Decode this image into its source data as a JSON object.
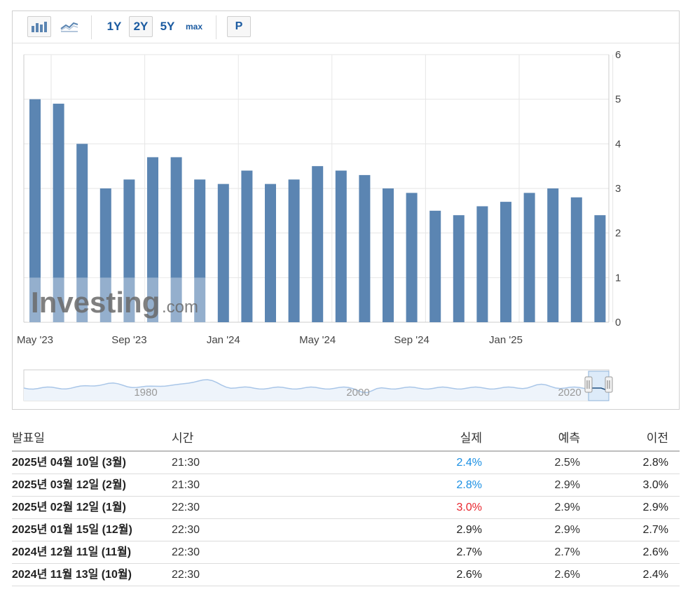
{
  "toolbar": {
    "bar_icon": "bar-chart-icon",
    "line_icon": "line-chart-icon",
    "ranges": [
      "1Y",
      "2Y",
      "5Y",
      "max"
    ],
    "active_range": "2Y",
    "p_label": "P"
  },
  "colors": {
    "bar": "#5b85b2",
    "grid": "#e6e6e6",
    "actual_blue": "#1a8fe3",
    "actual_red": "#e8242c",
    "navigator_line": "#a9c6e8",
    "navigator_fill": "#eef4fb"
  },
  "chart_data": {
    "type": "bar",
    "categories": [
      "May '23",
      "Jun '23",
      "Jul '23",
      "Aug '23",
      "Sep '23",
      "Oct '23",
      "Nov '23",
      "Dec '23",
      "Jan '24",
      "Feb '24",
      "Mar '24",
      "Apr '24",
      "May '24",
      "Jun '24",
      "Jul '24",
      "Aug '24",
      "Sep '24",
      "Oct '24",
      "Nov '24",
      "Dec '24",
      "Jan '25",
      "Feb '25",
      "Mar '25",
      "Apr '25"
    ],
    "values": [
      5.0,
      4.9,
      4.0,
      3.0,
      3.2,
      3.7,
      3.7,
      3.2,
      3.1,
      3.4,
      3.1,
      3.2,
      3.5,
      3.4,
      3.3,
      3.0,
      2.9,
      2.5,
      2.4,
      2.6,
      2.7,
      2.9,
      3.0,
      2.8,
      2.4
    ],
    "x_tick_labels": [
      "May '23",
      "Sep '23",
      "Jan '24",
      "May '24",
      "Sep '24",
      "Jan '25"
    ],
    "y_ticks": [
      0,
      1,
      2,
      3,
      4,
      5,
      6
    ],
    "ylim": [
      0,
      6
    ],
    "y_axis_side": "right",
    "grid": true,
    "watermark": "Investing.com",
    "navigator_labels": [
      "1980",
      "2000",
      "2020"
    ]
  },
  "table": {
    "headers": {
      "date": "발표일",
      "time": "시간",
      "actual": "실제",
      "forecast": "예측",
      "previous": "이전"
    },
    "rows": [
      {
        "date": "2025년 04월 10일 (3월)",
        "time": "21:30",
        "actual": "2.4%",
        "actual_color": "#1a8fe3",
        "forecast": "2.5%",
        "previous": "2.8%"
      },
      {
        "date": "2025년 03월 12일 (2월)",
        "time": "21:30",
        "actual": "2.8%",
        "actual_color": "#1a8fe3",
        "forecast": "2.9%",
        "previous": "3.0%"
      },
      {
        "date": "2025년 02월 12일 (1월)",
        "time": "22:30",
        "actual": "3.0%",
        "actual_color": "#e8242c",
        "forecast": "2.9%",
        "previous": "2.9%"
      },
      {
        "date": "2025년 01월 15일 (12월)",
        "time": "22:30",
        "actual": "2.9%",
        "actual_color": "#222222",
        "forecast": "2.9%",
        "previous": "2.7%"
      },
      {
        "date": "2024년 12월 11일 (11월)",
        "time": "22:30",
        "actual": "2.7%",
        "actual_color": "#222222",
        "forecast": "2.7%",
        "previous": "2.6%"
      },
      {
        "date": "2024년 11월 13일 (10월)",
        "time": "22:30",
        "actual": "2.6%",
        "actual_color": "#222222",
        "forecast": "2.6%",
        "previous": "2.4%"
      }
    ]
  }
}
